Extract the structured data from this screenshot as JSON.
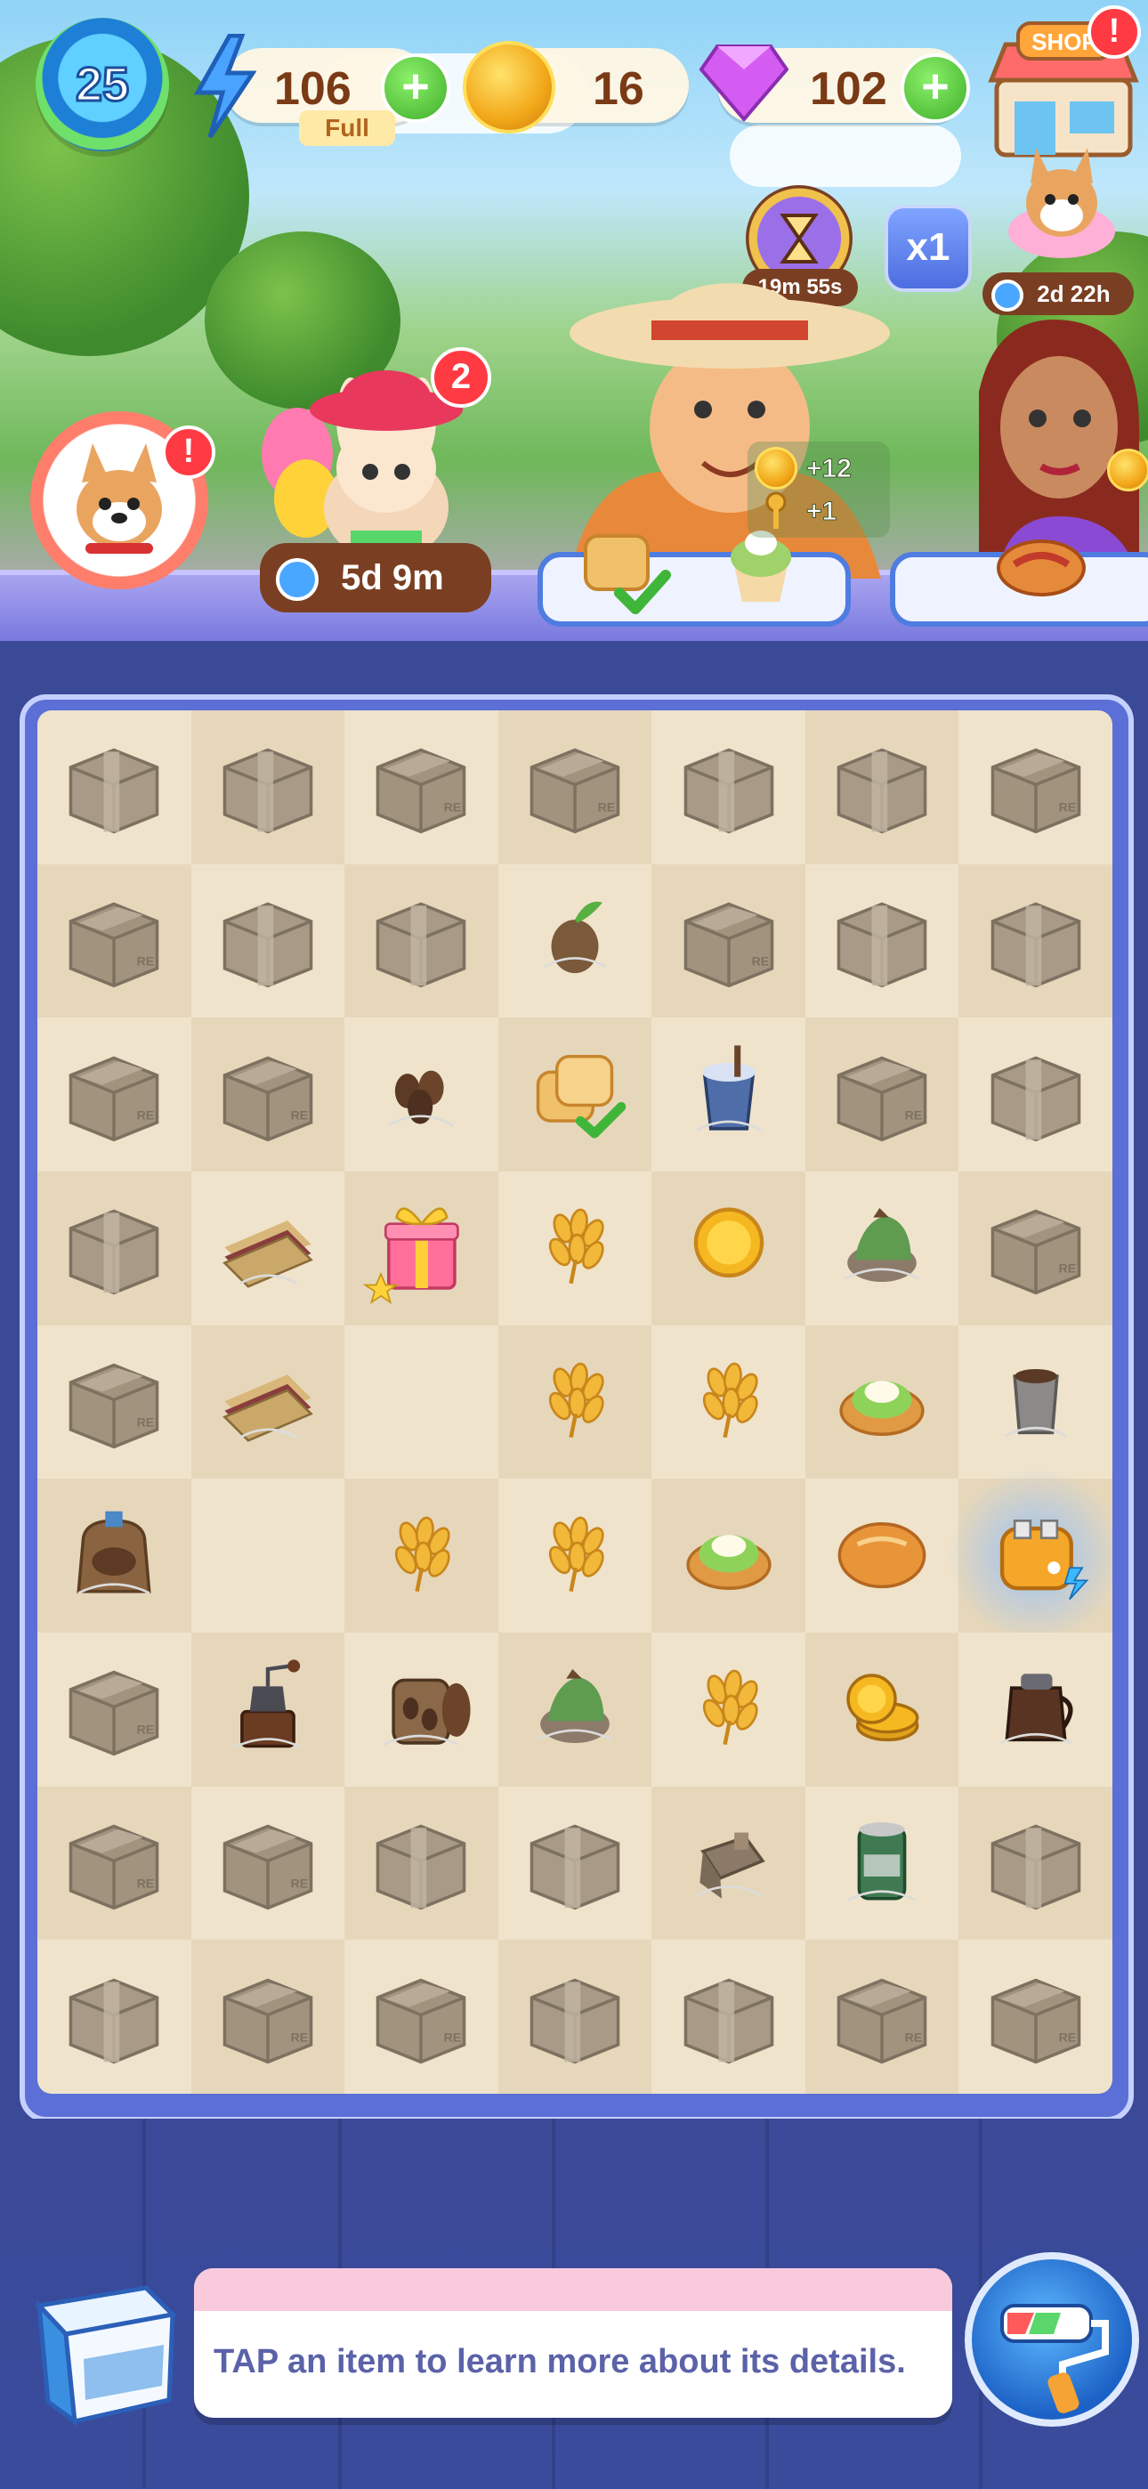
{
  "hud": {
    "level": "25",
    "energy": {
      "value": "106",
      "status": "Full"
    },
    "coins": {
      "value": "16"
    },
    "gems": {
      "value": "102"
    },
    "shop_label": "SHOP",
    "shop_alert": "!"
  },
  "scene": {
    "pet_alert": "!",
    "event_badge": "2",
    "event_timer": "5d 9m",
    "hourglass_timer": "19m 55s",
    "multiplier": "x1",
    "dog_event_timer": "2d 22h",
    "reward_coins": "+12",
    "reward_keys": "+1"
  },
  "board": {
    "columns": 7,
    "rows": 9,
    "cells": [
      [
        "box-taped",
        "box-taped",
        "box-re",
        "box-re",
        "box-taped",
        "box-taped",
        "box-re"
      ],
      [
        "box-re",
        "box-taped",
        "box-taped",
        "seed-web",
        "box-re",
        "box-taped",
        "box-taped"
      ],
      [
        "box-re",
        "box-re",
        "coffee-beans-web",
        "toast-check",
        "iced-coffee-web",
        "box-re",
        "box-taped"
      ],
      [
        "box-taped",
        "sandwich-web",
        "gift-box",
        "wheat",
        "coin",
        "matcha-mound-web",
        "box-re"
      ],
      [
        "box-re",
        "sandwich-web",
        "empty",
        "wheat",
        "wheat",
        "matcha-cookie",
        "cup-web"
      ],
      [
        "coffee-sack-web",
        "empty",
        "wheat",
        "wheat",
        "matcha-cookie",
        "bread-bun",
        "toaster-selected"
      ],
      [
        "box-re",
        "coffee-grinder-web",
        "coffee-beans-jar-web",
        "matcha-mound-web",
        "wheat",
        "coin-stack",
        "coffee-pot-web"
      ],
      [
        "box-re",
        "box-re",
        "box-taped",
        "box-taped",
        "bag-web",
        "tin-can-web",
        "box-taped"
      ],
      [
        "box-taped",
        "box-re",
        "box-re",
        "box-taped",
        "box-taped",
        "box-re",
        "box-re"
      ]
    ]
  },
  "bottom": {
    "info_text": "TAP an item to learn more about its details."
  },
  "colors": {
    "accent_green": "#3fae2a",
    "alert_red": "#ff3a43",
    "board_bg": "#efe3cb",
    "info_text": "#5b62a8"
  }
}
